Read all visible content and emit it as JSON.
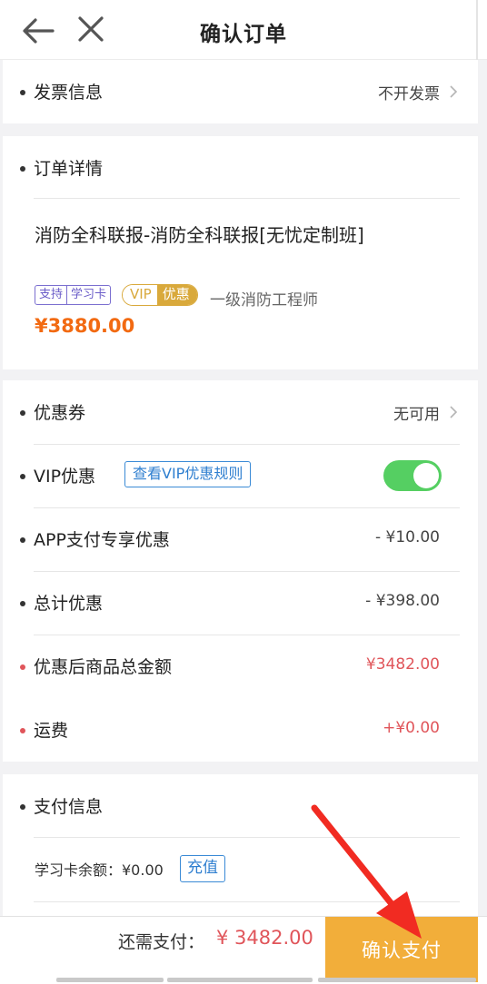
{
  "header": {
    "title": "确认订单"
  },
  "invoice": {
    "label": "发票信息",
    "value": "不开发票"
  },
  "order": {
    "section_title": "订单详情",
    "product_title": "消防全科联报-消防全科联报[无忧定制班]",
    "tags": {
      "support": "支持",
      "card": "学习卡",
      "vip": "VIP",
      "discount": "优惠"
    },
    "category": "一级消防工程师",
    "price": "¥3880.00"
  },
  "discounts": {
    "coupon_label": "优惠券",
    "coupon_value": "无可用",
    "vip_label": "VIP优惠",
    "vip_rule_link": "查看VIP优惠规则",
    "vip_enabled": true,
    "app_label": "APP支付专享优惠",
    "app_value": "- ¥10.00",
    "total_label": "总计优惠",
    "total_value": "- ¥398.00",
    "after_label": "优惠后商品总金额",
    "after_value": "¥3482.00",
    "shipping_label": "运费",
    "shipping_value": "+¥0.00"
  },
  "payment": {
    "section_title": "支付信息",
    "balance_label": "学习卡余额：¥0.00",
    "recharge_button": "充值"
  },
  "bottom": {
    "need_label": "还需支付：",
    "need_amount": "¥ 3482.00",
    "pay_button": "确认支付"
  },
  "colors": {
    "accent_orange": "#f2ae3a",
    "price_orange": "#f26a12",
    "red": "#e0555a",
    "link_blue": "#2f7fd0",
    "toggle_green": "#55cf62",
    "vip_gold": "#d9a93b",
    "annotation_red": "#f12b22"
  }
}
